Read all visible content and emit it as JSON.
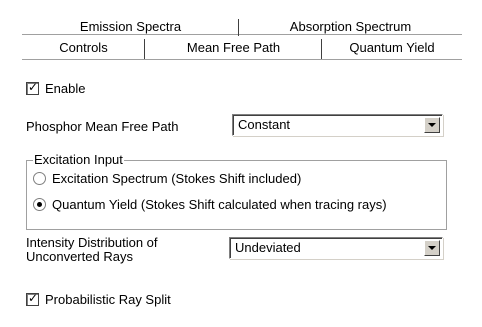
{
  "tabs": {
    "back_row": [
      "Emission Spectra",
      "Absorption Spectrum"
    ],
    "front_row": [
      "Controls",
      "Mean Free Path",
      "Quantum Yield"
    ],
    "active": "Controls"
  },
  "enable": {
    "label": "Enable",
    "checked": true
  },
  "phosphor_mfp": {
    "label": "Phosphor Mean Free Path",
    "value": "Constant"
  },
  "excitation": {
    "legend": "Excitation Input",
    "options": [
      "Excitation Spectrum (Stokes Shift included)",
      "Quantum Yield (Stokes Shift calculated when tracing rays)"
    ],
    "selected": "Quantum Yield (Stokes Shift calculated when tracing rays)"
  },
  "intensity": {
    "label_line1": "Intensity Distribution of",
    "label_line2": "Unconverted Rays",
    "value": "Undeviated"
  },
  "ray_split": {
    "label": "Probabilistic Ray Split",
    "checked": true
  },
  "icons": {
    "check": "✓-checkmark",
    "dropdown": "chevron-down-icon"
  }
}
